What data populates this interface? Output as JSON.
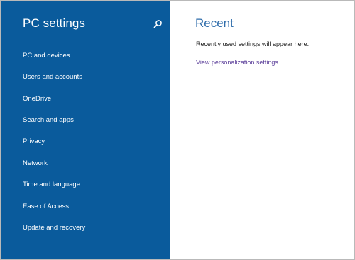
{
  "colors": {
    "sidebar_bg": "#0a5b9c",
    "sidebar_text": "#ffffff",
    "heading_accent": "#2f6dab",
    "link": "#5a3d99"
  },
  "sidebar": {
    "title": "PC settings",
    "search_icon": "search-icon",
    "items": [
      {
        "label": "PC and devices"
      },
      {
        "label": "Users and accounts"
      },
      {
        "label": "OneDrive"
      },
      {
        "label": "Search and apps"
      },
      {
        "label": "Privacy"
      },
      {
        "label": "Network"
      },
      {
        "label": "Time and language"
      },
      {
        "label": "Ease of Access"
      },
      {
        "label": "Update and recovery"
      }
    ]
  },
  "main": {
    "title": "Recent",
    "description": "Recently used settings will appear here.",
    "link": "View personalization settings"
  }
}
